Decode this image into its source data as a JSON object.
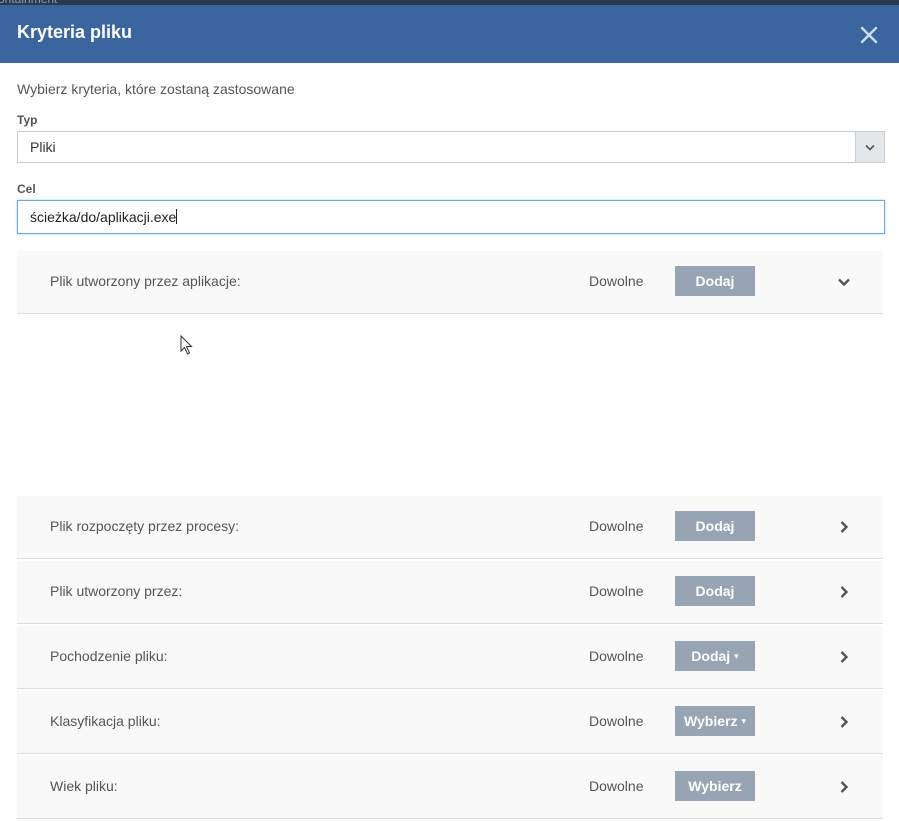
{
  "background": {
    "text": "ontainment"
  },
  "dialog": {
    "title": "Kryteria pliku",
    "subtitle": "Wybierz kryteria, które zostaną zastosowane",
    "type_label": "Typ",
    "type_value": "Pliki",
    "target_label": "Cel",
    "target_value": "ścieżka/do/aplikacji.exe",
    "close_icon": "close-icon"
  },
  "rows": [
    {
      "label": "Plik utworzony przez aplikacje:",
      "value": "Dowolne",
      "button": "Dodaj",
      "button_dropdown": false,
      "expanded": true
    },
    {
      "label": "Plik rozpoczęty przez procesy:",
      "value": "Dowolne",
      "button": "Dodaj",
      "button_dropdown": false,
      "expanded": false
    },
    {
      "label": "Plik utworzony przez:",
      "value": "Dowolne",
      "button": "Dodaj",
      "button_dropdown": false,
      "expanded": false
    },
    {
      "label": "Pochodzenie pliku:",
      "value": "Dowolne",
      "button": "Dodaj",
      "button_dropdown": true,
      "expanded": false
    },
    {
      "label": "Klasyfikacja pliku:",
      "value": "Dowolne",
      "button": "Wybierz",
      "button_dropdown": true,
      "expanded": false
    },
    {
      "label": "Wiek pliku:",
      "value": "Dowolne",
      "button": "Wybierz",
      "button_dropdown": false,
      "expanded": false
    }
  ],
  "colors": {
    "header": "#3a659e",
    "button": "#96a4b3",
    "input_focus_border": "#6fa8dc"
  }
}
